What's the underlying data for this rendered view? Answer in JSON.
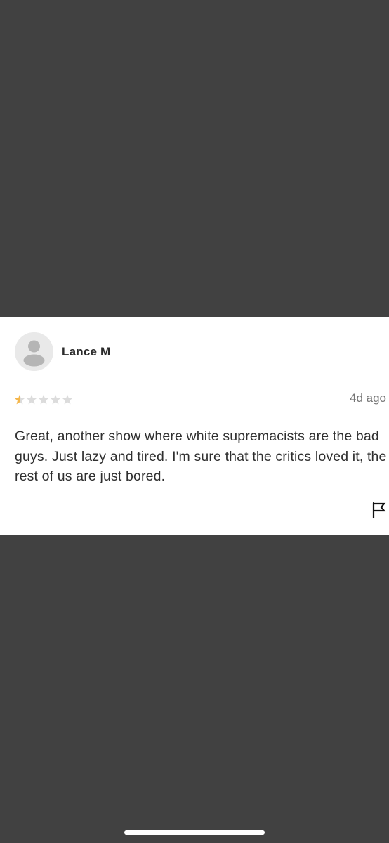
{
  "review": {
    "reviewer_name": "Lance M",
    "rating": 0.5,
    "rating_max": 5,
    "timestamp": "4d ago",
    "text": "Great, another show where white supremacists are the bad guys. Just lazy and tired. I'm sure that the critics loved it, the rest of us are just bored."
  },
  "icons": {
    "avatar": "person-placeholder-icon",
    "flag": "flag-icon",
    "star": "star-icon"
  },
  "colors": {
    "background": "#414141",
    "card": "#ffffff",
    "star_filled": "#f4b64b",
    "star_empty": "#dcdcdc",
    "text": "#2f2f2f",
    "muted": "#757575"
  }
}
